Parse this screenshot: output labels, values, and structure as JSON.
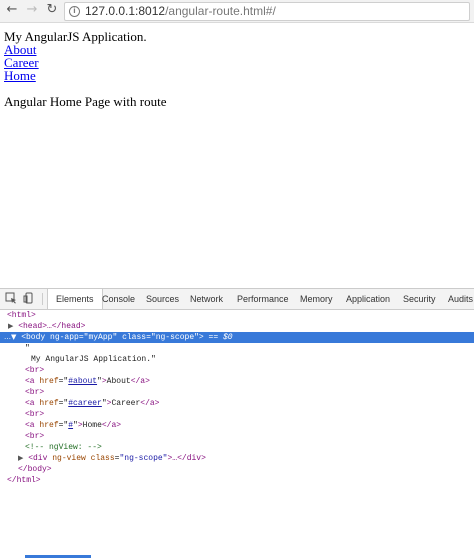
{
  "browser": {
    "url_host": "127.0.0.1:8012",
    "url_path": "/angular-route.html#/"
  },
  "page": {
    "heading": "My AngularJS Application.",
    "links": [
      "About",
      "Career",
      "Home"
    ],
    "view_text": "Angular Home Page with route"
  },
  "devtools": {
    "tabs": [
      "Elements",
      "Console",
      "Sources",
      "Network",
      "Performance",
      "Memory",
      "Application",
      "Security",
      "Audits"
    ],
    "active_tab": "Elements",
    "dom": {
      "html_open": "<html>",
      "head": "<head>…</head>",
      "body_tag": "<body",
      "body_attr1": "ng-app",
      "body_val1": "\"myApp\"",
      "body_attr2": "class",
      "body_val2": "\"ng-scope\"",
      "body_end": ">",
      "selected_marker": "== $0",
      "quote_open": "\"",
      "text_node": "My AngularJS Application.\"",
      "br": "<br>",
      "a_open": "<a",
      "href_attr": "href",
      "href_about": "#about",
      "href_career": "#career",
      "href_home": "#",
      "about_text": "About",
      "career_text": "Career",
      "home_text": "Home",
      "a_close": "</a>",
      "comment": "<!-- ngView:  -->",
      "div_tag": "<div",
      "div_attr": "ng-view",
      "div_attr2": "class",
      "div_val": "\"ng-scope\"",
      "div_rest": ">…</div>",
      "body_close": "</body>",
      "html_close": "</html>"
    }
  }
}
